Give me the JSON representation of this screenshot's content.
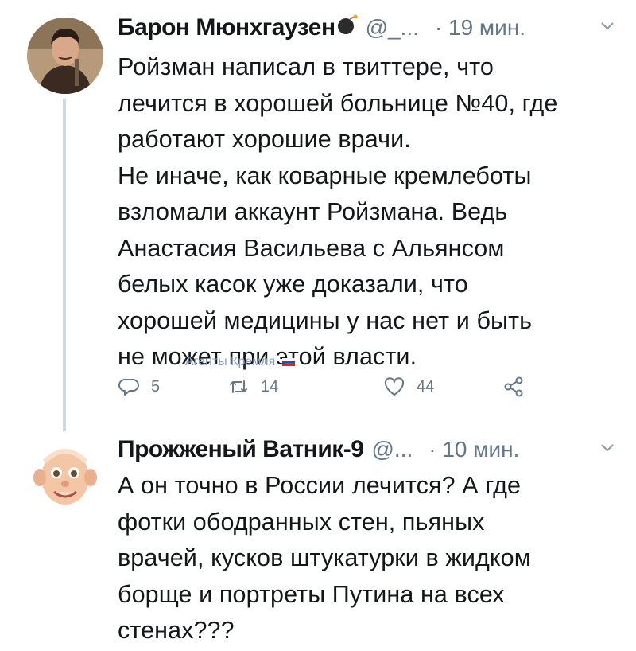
{
  "tweets": [
    {
      "author_name": "Барон Мюнхгаузен",
      "handle": "@_...",
      "time": "· 19 мин.",
      "text": "Ройзман написал в твиттере, что\nлечится в хорошей больнице №40, где\nработают хорошие врачи.\nНе иначе, как коварные кремлеботы\nвзломали аккаунт Ройзмана. Ведь\nАнастасия Васильева с Альянсом\nбелых касок уже доказали, что\nхорошей медицины у нас нет и быть\nне может при этой власти.",
      "watermark": "Агенты Кремля",
      "reply_count": "5",
      "retweet_count": "14",
      "like_count": "44"
    },
    {
      "author_name": "Прожженый Ватник-9",
      "handle": "@...",
      "time": "· 10 мин.",
      "text": "А он точно в России лечится? А где\nфотки ободранных стен, пьяных\nврачей, кусков штукатурки в жидком\nборще и портреты Путина на всех\nстенах???"
    }
  ],
  "icons": [
    "bomb-icon",
    "chevron-down-icon",
    "reply-icon",
    "retweet-icon",
    "like-icon",
    "share-icon",
    "flag-icon"
  ],
  "colors": {
    "muted": "#657786",
    "thread_line": "#cfd9de",
    "text": "#14171a",
    "watermark": "#8aa0c8"
  }
}
